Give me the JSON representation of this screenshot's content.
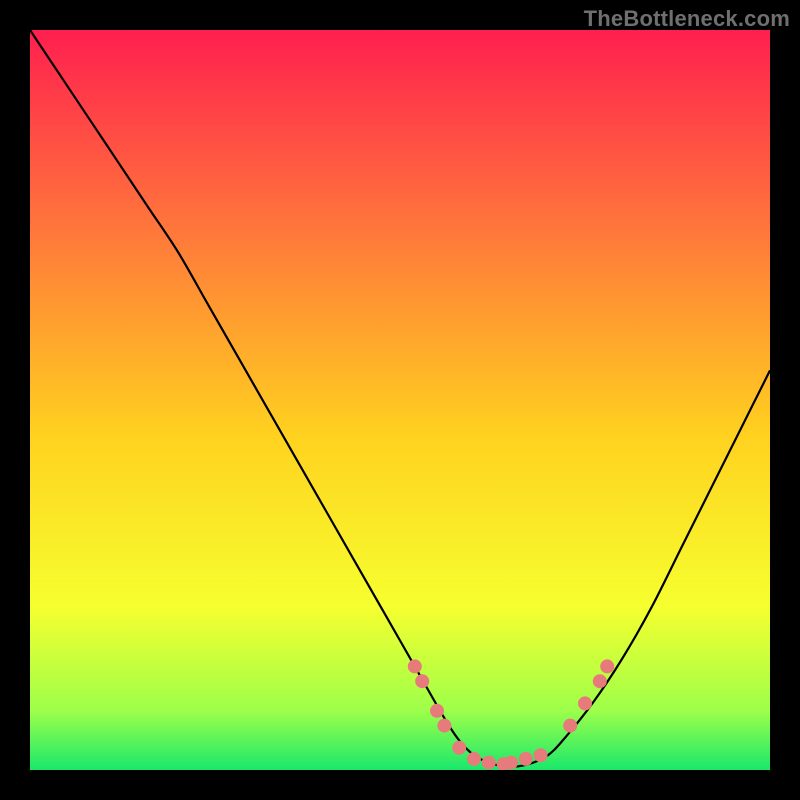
{
  "watermark": "TheBottleneck.com",
  "chart_data": {
    "type": "line",
    "title": "",
    "xlabel": "",
    "ylabel": "",
    "xlim": [
      0,
      100
    ],
    "ylim": [
      0,
      100
    ],
    "series": [
      {
        "name": "bottleneck-curve",
        "x": [
          0,
          4,
          8,
          12,
          16,
          20,
          24,
          28,
          32,
          36,
          40,
          44,
          48,
          52,
          56,
          58,
          60,
          62,
          64,
          66,
          68,
          70,
          72,
          76,
          80,
          84,
          88,
          92,
          96,
          100
        ],
        "y": [
          100,
          94,
          88,
          82,
          76,
          70,
          63,
          56,
          49,
          42,
          35,
          28,
          21,
          14,
          7,
          4,
          2,
          1,
          0.5,
          0.5,
          1,
          2,
          4,
          9,
          15,
          22,
          30,
          38,
          46,
          54
        ],
        "color": "#000000"
      }
    ],
    "markers": {
      "name": "highlighted-points",
      "color": "#e77b7b",
      "radius": 7,
      "points": [
        {
          "x": 52,
          "y": 14
        },
        {
          "x": 53,
          "y": 12
        },
        {
          "x": 55,
          "y": 8
        },
        {
          "x": 56,
          "y": 6
        },
        {
          "x": 58,
          "y": 3
        },
        {
          "x": 60,
          "y": 1.5
        },
        {
          "x": 62,
          "y": 1
        },
        {
          "x": 64,
          "y": 0.8
        },
        {
          "x": 65,
          "y": 1
        },
        {
          "x": 67,
          "y": 1.5
        },
        {
          "x": 69,
          "y": 2
        },
        {
          "x": 73,
          "y": 6
        },
        {
          "x": 75,
          "y": 9
        },
        {
          "x": 77,
          "y": 12
        },
        {
          "x": 78,
          "y": 14
        }
      ]
    },
    "background_gradient": {
      "top": "#ff1f4f",
      "mid_upper": "#ff7a3a",
      "mid": "#ffd21f",
      "mid_lower": "#f6ff2f",
      "near_bottom": "#9dff4a",
      "bottom": "#19e86b"
    }
  }
}
